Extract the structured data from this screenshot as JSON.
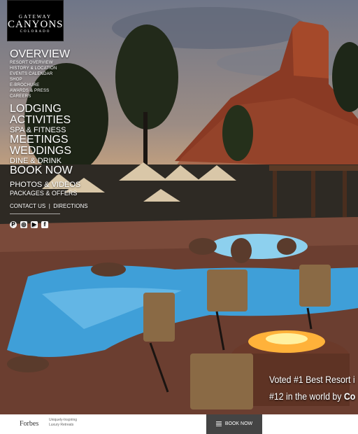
{
  "logo": {
    "line1": "GATEWAY",
    "line2": "CANYONS",
    "line3": "COLORADO"
  },
  "nav": {
    "overview": "OVERVIEW",
    "overview_items": [
      "RESORT OVERVIEW",
      "HISTORY & LOCATION",
      "EVENTS CALENDAR",
      "SHOP",
      "E-BROCHURE",
      "AWARDS & PRESS",
      "CAREERS"
    ],
    "lodging": "LODGING",
    "activities": "ACTIVITIES",
    "spa": "SPA & FITNESS",
    "meetings": "MEETINGS",
    "weddings": "WEDDINGS",
    "dine": "DINE & DRINK",
    "book": "BOOK NOW",
    "photos": "PHOTOS & VIDEOS",
    "packages": "PACKAGES & OFFERS",
    "contact": "CONTACT US",
    "separator": "|",
    "directions": "DIRECTIONS"
  },
  "social": [
    "pinterest-icon",
    "instagram-icon",
    "youtube-icon",
    "facebook-icon"
  ],
  "ribbon": {
    "line1": "Voted #1 Best Resort i",
    "line2_prefix": "#12 in the world by ",
    "line2_bold": "Co"
  },
  "footer": {
    "forbes": "Forbes",
    "tagline_line1": "Uniquely-Inspiring",
    "tagline_line2": "Luxury Retreats",
    "book_now": "BOOK NOW"
  }
}
